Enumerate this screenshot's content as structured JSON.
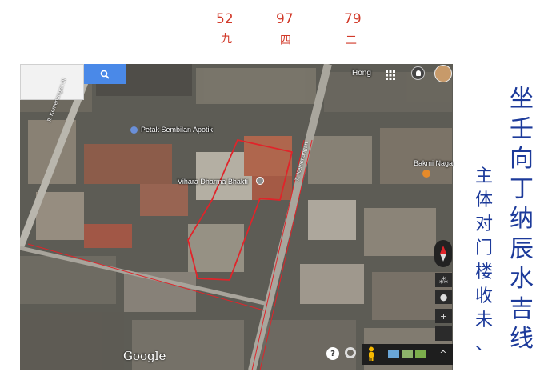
{
  "annotations_top": [
    {
      "number": "52",
      "numeral": "九"
    },
    {
      "number": "97",
      "numeral": "四"
    },
    {
      "number": "79",
      "numeral": "二"
    }
  ],
  "map": {
    "poi_labels": {
      "apotik": "Petak Sembilan Apotik",
      "vihara": "Vihara Dharma Bhakti",
      "bakmi": "Bakmi Naga"
    },
    "streets": {
      "left": "Jl. Kemenangan III",
      "right": "Jl. Kemenangan"
    },
    "user_name": "Hong",
    "logo": "Google",
    "help_label": "?",
    "zoom_in": "+",
    "zoom_out": "−",
    "expand_label": "^"
  },
  "handwriting_right": "坐壬向丁纳辰水吉线",
  "handwriting_right2": "主体对门楼收未、",
  "colors": {
    "annotation_red": "#d23a2a",
    "annotation_blue": "#1c3a9a",
    "search_blue": "#4a89e8",
    "boundary": "#e0242a"
  }
}
